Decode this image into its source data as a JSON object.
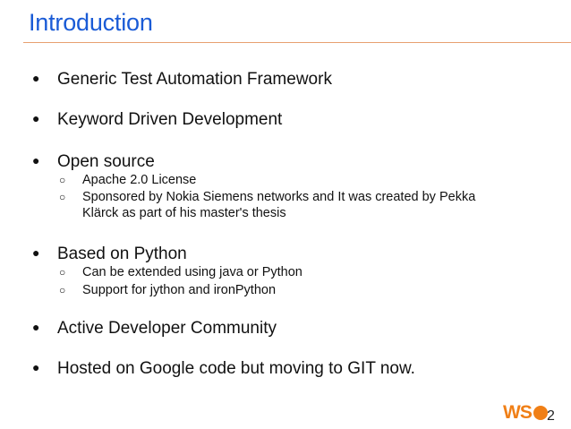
{
  "slide": {
    "title": "Introduction",
    "bullets": [
      {
        "text": "Generic Test Automation Framework",
        "sub": []
      },
      {
        "text": "Keyword Driven Development",
        "sub": []
      },
      {
        "text": "Open source",
        "sub": [
          "Apache 2.0 License",
          "Sponsored by Nokia Siemens networks and It was created by Pekka Klärck as part of his master's thesis"
        ]
      },
      {
        "text": "Based on Python",
        "sub": [
          "Can be extended using java or Python",
          "Support for jython and ironPython"
        ]
      },
      {
        "text": "Active Developer Community",
        "sub": []
      },
      {
        "text": "Hosted on Google code but moving to GIT now.",
        "sub": []
      }
    ],
    "bullet_glyph": "●",
    "sub_bullet_glyph": "○"
  },
  "logo": {
    "letters": "WS",
    "subscript": "2",
    "color": "#f07f16"
  },
  "colors": {
    "title": "#1a5bd6",
    "rule": "#e8a070",
    "text": "#111111"
  }
}
